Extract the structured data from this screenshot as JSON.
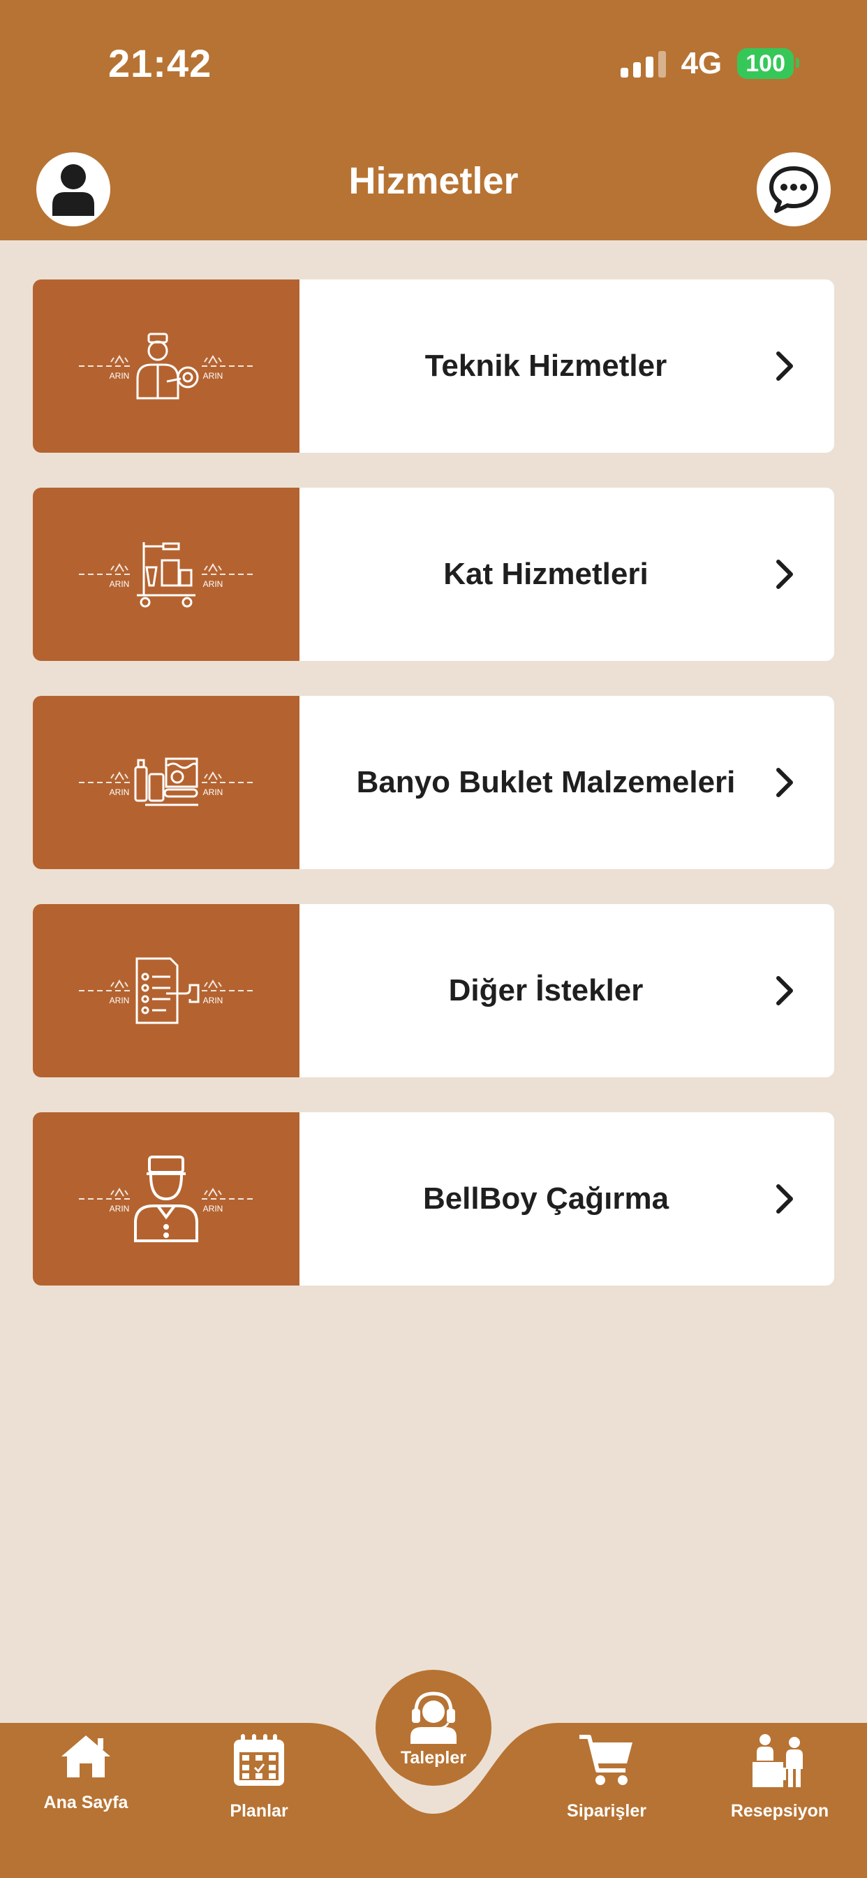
{
  "status_bar": {
    "time": "21:42",
    "network": "4G",
    "battery": "100"
  },
  "header": {
    "title": "Hizmetler",
    "profile_icon": "user-icon",
    "chat_icon": "chat-bubble-icon"
  },
  "services": [
    {
      "label": "Teknik Hizmetler",
      "icon": "technician-icon"
    },
    {
      "label": "Kat Hizmetleri",
      "icon": "housekeeping-cart-icon"
    },
    {
      "label": "Banyo Buklet Malzemeleri",
      "icon": "toiletries-icon"
    },
    {
      "label": "Diğer İstekler",
      "icon": "request-list-icon"
    },
    {
      "label": "BellBoy Çağırma",
      "icon": "bellboy-icon"
    }
  ],
  "logo_text": "ARIN",
  "tabbar": {
    "tabs": [
      {
        "label": "Ana Sayfa",
        "icon": "home-icon"
      },
      {
        "label": "Planlar",
        "icon": "calendar-icon"
      },
      {
        "label": "Talepler",
        "icon": "headset-agent-icon",
        "active": true
      },
      {
        "label": "Siparişler",
        "icon": "shopping-cart-icon"
      },
      {
        "label": "Resepsiyon",
        "icon": "reception-icon"
      }
    ]
  },
  "colors": {
    "header": "#b77333",
    "card_image": "#b46330",
    "background": "#ece0d4",
    "battery": "#36c759"
  }
}
